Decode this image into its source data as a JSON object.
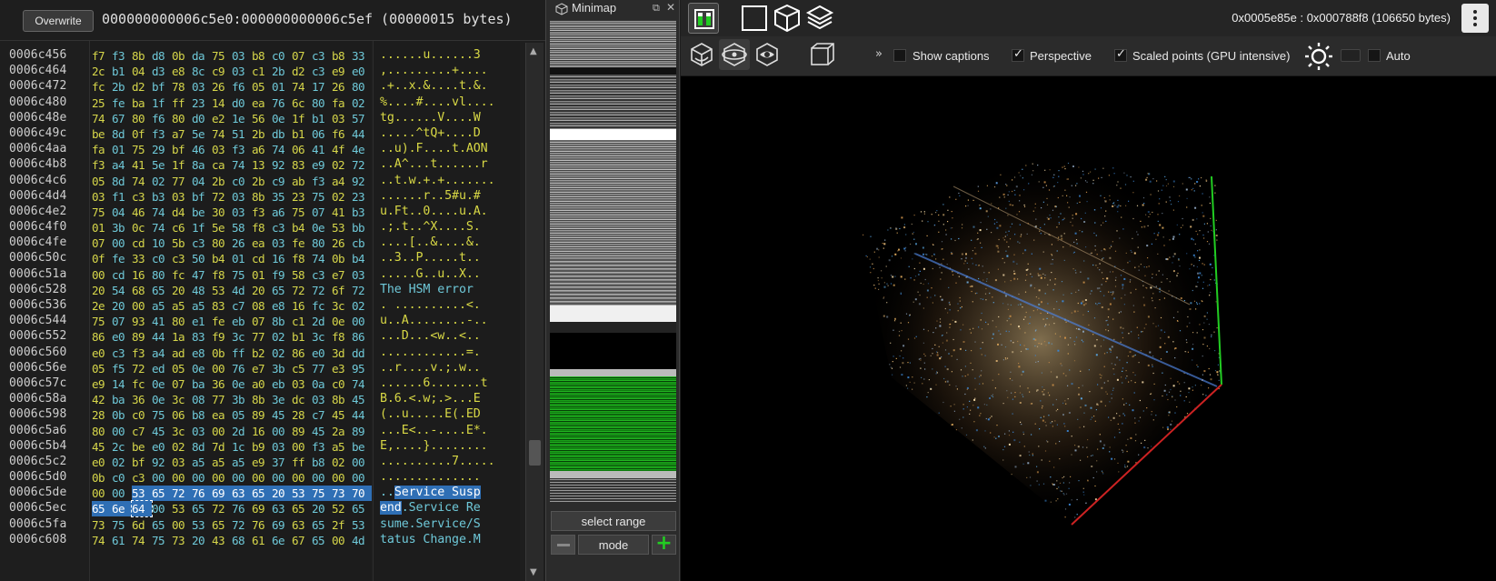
{
  "hexview": {
    "overwrite_label": "Overwrite",
    "selection_info": "000000000006c5e0:000000000006c5ef (00000015 bytes)",
    "rows": [
      {
        "addr": "0006c456",
        "bytes": [
          "f7",
          "f3",
          "8b",
          "d8",
          "0b",
          "da",
          "75",
          "03",
          "b8",
          "c0",
          "07",
          "c3",
          "b8",
          "33"
        ],
        "ascii": "......u......3"
      },
      {
        "addr": "0006c464",
        "bytes": [
          "2c",
          "b1",
          "04",
          "d3",
          "e8",
          "8c",
          "c9",
          "03",
          "c1",
          "2b",
          "d2",
          "c3",
          "e9",
          "e0"
        ],
        "ascii": ",.........+...."
      },
      {
        "addr": "0006c472",
        "bytes": [
          "fc",
          "2b",
          "d2",
          "bf",
          "78",
          "03",
          "26",
          "f6",
          "05",
          "01",
          "74",
          "17",
          "26",
          "80"
        ],
        "ascii": ".+..x.&....t.&."
      },
      {
        "addr": "0006c480",
        "bytes": [
          "25",
          "fe",
          "ba",
          "1f",
          "ff",
          "23",
          "14",
          "d0",
          "ea",
          "76",
          "6c",
          "80",
          "fa",
          "02"
        ],
        "ascii": "%....#....vl...."
      },
      {
        "addr": "0006c48e",
        "bytes": [
          "74",
          "67",
          "80",
          "f6",
          "80",
          "d0",
          "e2",
          "1e",
          "56",
          "0e",
          "1f",
          "b1",
          "03",
          "57"
        ],
        "ascii": "tg......V....W"
      },
      {
        "addr": "0006c49c",
        "bytes": [
          "be",
          "8d",
          "0f",
          "f3",
          "a7",
          "5e",
          "74",
          "51",
          "2b",
          "db",
          "b1",
          "06",
          "f6",
          "44"
        ],
        "ascii": ".....^tQ+....D"
      },
      {
        "addr": "0006c4aa",
        "bytes": [
          "fa",
          "01",
          "75",
          "29",
          "bf",
          "46",
          "03",
          "f3",
          "a6",
          "74",
          "06",
          "41",
          "4f",
          "4e"
        ],
        "ascii": "..u).F....t.AON"
      },
      {
        "addr": "0006c4b8",
        "bytes": [
          "f3",
          "a4",
          "41",
          "5e",
          "1f",
          "8a",
          "ca",
          "74",
          "13",
          "92",
          "83",
          "e9",
          "02",
          "72"
        ],
        "ascii": "..A^...t......r"
      },
      {
        "addr": "0006c4c6",
        "bytes": [
          "05",
          "8d",
          "74",
          "02",
          "77",
          "04",
          "2b",
          "c0",
          "2b",
          "c9",
          "ab",
          "f3",
          "a4",
          "92"
        ],
        "ascii": "..t.w.+.+......."
      },
      {
        "addr": "0006c4d4",
        "bytes": [
          "03",
          "f1",
          "c3",
          "b3",
          "03",
          "bf",
          "72",
          "03",
          "8b",
          "35",
          "23",
          "75",
          "02",
          "23"
        ],
        "ascii": "......r..5#u.#"
      },
      {
        "addr": "0006c4e2",
        "bytes": [
          "75",
          "04",
          "46",
          "74",
          "d4",
          "be",
          "30",
          "03",
          "f3",
          "a6",
          "75",
          "07",
          "41",
          "b3"
        ],
        "ascii": "u.Ft..0....u.A."
      },
      {
        "addr": "0006c4f0",
        "bytes": [
          "01",
          "3b",
          "0c",
          "74",
          "c6",
          "1f",
          "5e",
          "58",
          "f8",
          "c3",
          "b4",
          "0e",
          "53",
          "bb"
        ],
        "ascii": ".;.t..^X....S."
      },
      {
        "addr": "0006c4fe",
        "bytes": [
          "07",
          "00",
          "cd",
          "10",
          "5b",
          "c3",
          "80",
          "26",
          "ea",
          "03",
          "fe",
          "80",
          "26",
          "cb"
        ],
        "ascii": "....[..&....&."
      },
      {
        "addr": "0006c50c",
        "bytes": [
          "0f",
          "fe",
          "33",
          "c0",
          "c3",
          "50",
          "b4",
          "01",
          "cd",
          "16",
          "f8",
          "74",
          "0b",
          "b4"
        ],
        "ascii": "..3..P.....t.."
      },
      {
        "addr": "0006c51a",
        "bytes": [
          "00",
          "cd",
          "16",
          "80",
          "fc",
          "47",
          "f8",
          "75",
          "01",
          "f9",
          "58",
          "c3",
          "e7",
          "03"
        ],
        "ascii": ".....G..u..X.."
      },
      {
        "addr": "0006c528",
        "bytes": [
          "20",
          "54",
          "68",
          "65",
          "20",
          "48",
          "53",
          "4d",
          "20",
          "65",
          "72",
          "72",
          "6f",
          "72"
        ],
        "ascii": " The HSM error"
      },
      {
        "addr": "0006c536",
        "bytes": [
          "2e",
          "20",
          "00",
          "a5",
          "a5",
          "a5",
          "83",
          "c7",
          "08",
          "e8",
          "16",
          "fc",
          "3c",
          "02"
        ],
        "ascii": ". ..........<."
      },
      {
        "addr": "0006c544",
        "bytes": [
          "75",
          "07",
          "93",
          "41",
          "80",
          "e1",
          "fe",
          "eb",
          "07",
          "8b",
          "c1",
          "2d",
          "0e",
          "00"
        ],
        "ascii": "u..A........-.."
      },
      {
        "addr": "0006c552",
        "bytes": [
          "86",
          "e0",
          "89",
          "44",
          "1a",
          "83",
          "f9",
          "3c",
          "77",
          "02",
          "b1",
          "3c",
          "f8",
          "86"
        ],
        "ascii": "...D...<w..<.."
      },
      {
        "addr": "0006c560",
        "bytes": [
          "e0",
          "c3",
          "f3",
          "a4",
          "ad",
          "e8",
          "0b",
          "ff",
          "b2",
          "02",
          "86",
          "e0",
          "3d",
          "dd"
        ],
        "ascii": "............=."
      },
      {
        "addr": "0006c56e",
        "bytes": [
          "05",
          "f5",
          "72",
          "ed",
          "05",
          "0e",
          "00",
          "76",
          "e7",
          "3b",
          "c5",
          "77",
          "e3",
          "95"
        ],
        "ascii": "..r....v.;.w.."
      },
      {
        "addr": "0006c57c",
        "bytes": [
          "e9",
          "14",
          "fc",
          "0e",
          "07",
          "ba",
          "36",
          "0e",
          "a0",
          "eb",
          "03",
          "0a",
          "c0",
          "74"
        ],
        "ascii": "......6.......t"
      },
      {
        "addr": "0006c58a",
        "bytes": [
          "42",
          "ba",
          "36",
          "0e",
          "3c",
          "08",
          "77",
          "3b",
          "8b",
          "3e",
          "dc",
          "03",
          "8b",
          "45"
        ],
        "ascii": "B.6.<.w;.>...E"
      },
      {
        "addr": "0006c598",
        "bytes": [
          "28",
          "0b",
          "c0",
          "75",
          "06",
          "b8",
          "ea",
          "05",
          "89",
          "45",
          "28",
          "c7",
          "45",
          "44"
        ],
        "ascii": "(..u.....E(.ED"
      },
      {
        "addr": "0006c5a6",
        "bytes": [
          "80",
          "00",
          "c7",
          "45",
          "3c",
          "03",
          "00",
          "2d",
          "16",
          "00",
          "89",
          "45",
          "2a",
          "89"
        ],
        "ascii": "...E<..-....E*."
      },
      {
        "addr": "0006c5b4",
        "bytes": [
          "45",
          "2c",
          "be",
          "e0",
          "02",
          "8d",
          "7d",
          "1c",
          "b9",
          "03",
          "00",
          "f3",
          "a5",
          "be"
        ],
        "ascii": "E,....}........"
      },
      {
        "addr": "0006c5c2",
        "bytes": [
          "e0",
          "02",
          "bf",
          "92",
          "03",
          "a5",
          "a5",
          "a5",
          "e9",
          "37",
          "ff",
          "b8",
          "02",
          "00"
        ],
        "ascii": "..........7....."
      },
      {
        "addr": "0006c5d0",
        "bytes": [
          "0b",
          "c0",
          "c3",
          "00",
          "00",
          "00",
          "00",
          "00",
          "00",
          "00",
          "00",
          "00",
          "00",
          "00"
        ],
        "ascii": ".............."
      },
      {
        "addr": "0006c5de",
        "bytes": [
          "00",
          "00",
          "53",
          "65",
          "72",
          "76",
          "69",
          "63",
          "65",
          "20",
          "53",
          "75",
          "73",
          "70"
        ],
        "ascii": "..Service Susp"
      },
      {
        "addr": "0006c5ec",
        "bytes": [
          "65",
          "6e",
          "64",
          "00",
          "53",
          "65",
          "72",
          "76",
          "69",
          "63",
          "65",
          "20",
          "52",
          "65"
        ],
        "ascii": "end.Service Re"
      },
      {
        "addr": "0006c5fa",
        "bytes": [
          "73",
          "75",
          "6d",
          "65",
          "00",
          "53",
          "65",
          "72",
          "76",
          "69",
          "63",
          "65",
          "2f",
          "53"
        ],
        "ascii": "sume.Service/S"
      },
      {
        "addr": "0006c608",
        "bytes": [
          "74",
          "61",
          "74",
          "75",
          "73",
          "20",
          "43",
          "68",
          "61",
          "6e",
          "67",
          "65",
          "00",
          "4d"
        ],
        "ascii": "tatus Change.M"
      }
    ]
  },
  "minimap": {
    "title": "Minimap",
    "float_icon": "float-icon",
    "close_icon": "close-icon",
    "select_label": "select range",
    "mode_label": "mode",
    "plus_label": "+"
  },
  "view3d": {
    "range_label": "0x0005e85e : 0x000788f8 (106650 bytes)",
    "show_captions_label": "Show captions",
    "show_captions": false,
    "perspective_label": "Perspective",
    "perspective": true,
    "scaled_points_label": "Scaled points (GPU intensive)",
    "scaled_points": true,
    "auto_label": "Auto",
    "auto": false,
    "colors": {
      "selection": "#2f6fb5",
      "minimap_green": "#1aa31a",
      "axis_green": "#22cc22",
      "axis_red": "#cc2222"
    }
  }
}
